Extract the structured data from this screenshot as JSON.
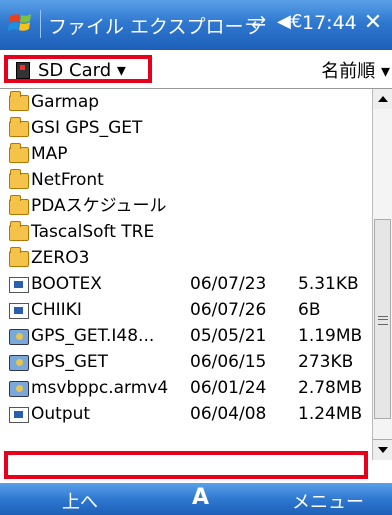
{
  "titlebar": {
    "title": "ファイル エクスプローラ",
    "time": "17:44",
    "connectivity_icon": "⇄",
    "volume_icon": "◀€",
    "close_label": "✕"
  },
  "toolbar": {
    "location_label": "SD Card ▾",
    "sort_label": "名前順 ▾"
  },
  "files": [
    {
      "type": "folder",
      "name": "Garmap",
      "date": "",
      "size": ""
    },
    {
      "type": "folder",
      "name": "GSI GPS_GET",
      "date": "",
      "size": ""
    },
    {
      "type": "folder",
      "name": "MAP",
      "date": "",
      "size": ""
    },
    {
      "type": "folder",
      "name": "NetFront",
      "date": "",
      "size": ""
    },
    {
      "type": "folder",
      "name": "PDAスケジュール",
      "date": "",
      "size": ""
    },
    {
      "type": "folder",
      "name": "TascalSoft TRE",
      "date": "",
      "size": ""
    },
    {
      "type": "folder",
      "name": "ZERO3",
      "date": "",
      "size": ""
    },
    {
      "type": "file",
      "name": "BOOTEX",
      "date": "06/07/23",
      "size": "5.31KB"
    },
    {
      "type": "file",
      "name": "CHIIKI",
      "date": "06/07/26",
      "size": "6B"
    },
    {
      "type": "exe",
      "name": "GPS_GET.I48...",
      "date": "05/05/21",
      "size": "1.19MB"
    },
    {
      "type": "exe",
      "name": "GPS_GET",
      "date": "06/06/15",
      "size": "273KB"
    },
    {
      "type": "exe",
      "name": "msvbppc.armv4",
      "date": "06/01/24",
      "size": "2.78MB"
    },
    {
      "type": "file",
      "name": "Output",
      "date": "06/04/08",
      "size": "1.24MB"
    }
  ],
  "softkeys": {
    "left": "上へ",
    "middle": "A",
    "right": "メニュー"
  },
  "colors": {
    "titlebar": "#2f78d0",
    "highlight_box": "#e6001a"
  }
}
